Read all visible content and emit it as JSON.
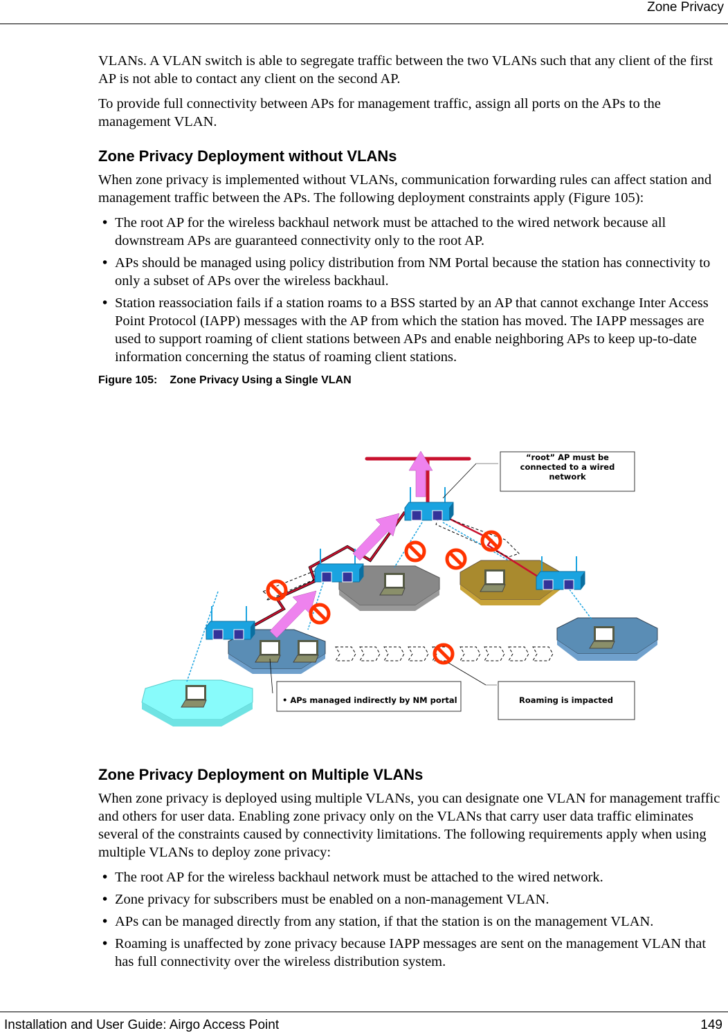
{
  "header": {
    "title": "Zone Privacy"
  },
  "intro": {
    "p1": "VLANs. A VLAN switch is able to segregate traffic between the two VLANs such that any client of the first AP is not able to contact any client on the second AP.",
    "p2": "To provide full connectivity between APs for management traffic, assign all ports on the APs to the management VLAN."
  },
  "section1": {
    "heading": "Zone Privacy Deployment without VLANs",
    "body": "When zone privacy is implemented without VLANs, communication forwarding rules can affect station and management traffic between the APs. The following deployment constraints apply (Figure 105):",
    "bullets": [
      "The root AP for the wireless backhaul network must be attached to the wired network because all downstream APs are guaranteed connectivity only to the root AP.",
      "APs should be managed using policy distribution from NM Portal because the station has connectivity to only a subset of APs over the wireless backhaul.",
      "Station reassociation fails if a station roams to a BSS started by an AP that cannot exchange Inter Access Point Protocol (IAPP) messages with the AP from which the station has moved. The IAPP messages are used to support roaming of client stations between APs and enable neighboring APs to keep up-to-date information concerning the status of roaming client stations."
    ]
  },
  "figure": {
    "number": "Figure 105:",
    "title": "Zone Privacy Using a Single VLAN",
    "callouts": {
      "root_line1": "“root” AP must be",
      "root_line2": "connected to a wired",
      "root_line3": "network",
      "managed": "• APs managed indirectly by NM portal",
      "roaming": "Roaming is impacted"
    },
    "colors": {
      "ap": "#1aa3e0",
      "wired": "#c8102e",
      "arrow": "#ee82ee",
      "no_sign": "#ff3300",
      "zone_cyan": "#88fbfb",
      "zone_blue": "#5a8db5",
      "zone_gray": "#888888",
      "zone_gold": "#a98a2e"
    }
  },
  "section2": {
    "heading": "Zone Privacy Deployment on Multiple VLANs",
    "body": "When zone privacy is deployed using multiple VLANs, you can designate one VLAN for management traffic and others for user data. Enabling zone privacy only on the VLANs that carry user data traffic eliminates several of the constraints caused by connectivity limitations. The following requirements apply when using multiple VLANs to deploy zone privacy:",
    "bullets": [
      "The root AP for the wireless backhaul network must be attached to the wired network.",
      "Zone privacy for subscribers must be enabled on a non-management VLAN.",
      "APs can be managed directly from any station, if that the station is on the management VLAN.",
      "Roaming is unaffected by zone privacy because IAPP messages are sent on the management VLAN that has full connectivity over the wireless distribution system."
    ]
  },
  "footer": {
    "left": "Installation and User Guide: Airgo Access Point",
    "page": "149"
  }
}
